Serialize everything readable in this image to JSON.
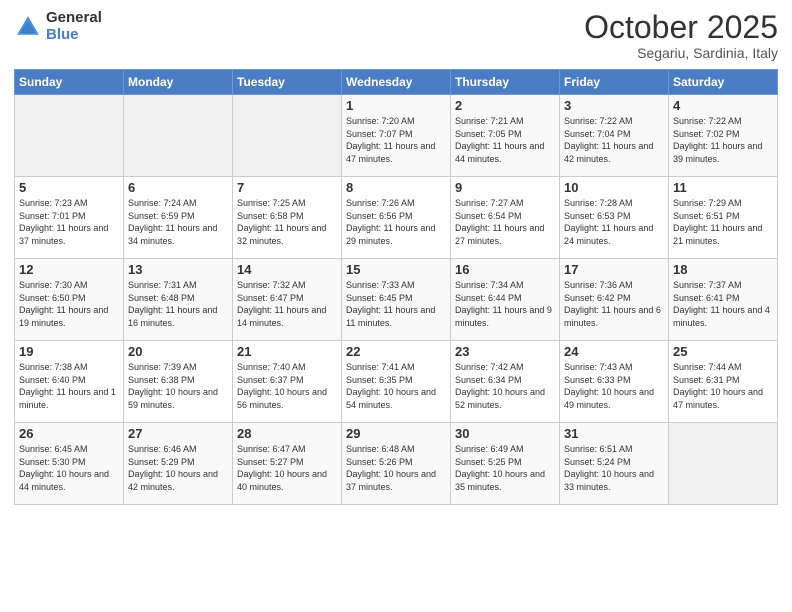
{
  "header": {
    "logo_line1": "General",
    "logo_line2": "Blue",
    "title": "October 2025",
    "subtitle": "Segariu, Sardinia, Italy"
  },
  "days_of_week": [
    "Sunday",
    "Monday",
    "Tuesday",
    "Wednesday",
    "Thursday",
    "Friday",
    "Saturday"
  ],
  "weeks": [
    [
      {
        "day": "",
        "content": ""
      },
      {
        "day": "",
        "content": ""
      },
      {
        "day": "",
        "content": ""
      },
      {
        "day": "1",
        "content": "Sunrise: 7:20 AM\nSunset: 7:07 PM\nDaylight: 11 hours and 47 minutes."
      },
      {
        "day": "2",
        "content": "Sunrise: 7:21 AM\nSunset: 7:05 PM\nDaylight: 11 hours and 44 minutes."
      },
      {
        "day": "3",
        "content": "Sunrise: 7:22 AM\nSunset: 7:04 PM\nDaylight: 11 hours and 42 minutes."
      },
      {
        "day": "4",
        "content": "Sunrise: 7:22 AM\nSunset: 7:02 PM\nDaylight: 11 hours and 39 minutes."
      }
    ],
    [
      {
        "day": "5",
        "content": "Sunrise: 7:23 AM\nSunset: 7:01 PM\nDaylight: 11 hours and 37 minutes."
      },
      {
        "day": "6",
        "content": "Sunrise: 7:24 AM\nSunset: 6:59 PM\nDaylight: 11 hours and 34 minutes."
      },
      {
        "day": "7",
        "content": "Sunrise: 7:25 AM\nSunset: 6:58 PM\nDaylight: 11 hours and 32 minutes."
      },
      {
        "day": "8",
        "content": "Sunrise: 7:26 AM\nSunset: 6:56 PM\nDaylight: 11 hours and 29 minutes."
      },
      {
        "day": "9",
        "content": "Sunrise: 7:27 AM\nSunset: 6:54 PM\nDaylight: 11 hours and 27 minutes."
      },
      {
        "day": "10",
        "content": "Sunrise: 7:28 AM\nSunset: 6:53 PM\nDaylight: 11 hours and 24 minutes."
      },
      {
        "day": "11",
        "content": "Sunrise: 7:29 AM\nSunset: 6:51 PM\nDaylight: 11 hours and 21 minutes."
      }
    ],
    [
      {
        "day": "12",
        "content": "Sunrise: 7:30 AM\nSunset: 6:50 PM\nDaylight: 11 hours and 19 minutes."
      },
      {
        "day": "13",
        "content": "Sunrise: 7:31 AM\nSunset: 6:48 PM\nDaylight: 11 hours and 16 minutes."
      },
      {
        "day": "14",
        "content": "Sunrise: 7:32 AM\nSunset: 6:47 PM\nDaylight: 11 hours and 14 minutes."
      },
      {
        "day": "15",
        "content": "Sunrise: 7:33 AM\nSunset: 6:45 PM\nDaylight: 11 hours and 11 minutes."
      },
      {
        "day": "16",
        "content": "Sunrise: 7:34 AM\nSunset: 6:44 PM\nDaylight: 11 hours and 9 minutes."
      },
      {
        "day": "17",
        "content": "Sunrise: 7:36 AM\nSunset: 6:42 PM\nDaylight: 11 hours and 6 minutes."
      },
      {
        "day": "18",
        "content": "Sunrise: 7:37 AM\nSunset: 6:41 PM\nDaylight: 11 hours and 4 minutes."
      }
    ],
    [
      {
        "day": "19",
        "content": "Sunrise: 7:38 AM\nSunset: 6:40 PM\nDaylight: 11 hours and 1 minute."
      },
      {
        "day": "20",
        "content": "Sunrise: 7:39 AM\nSunset: 6:38 PM\nDaylight: 10 hours and 59 minutes."
      },
      {
        "day": "21",
        "content": "Sunrise: 7:40 AM\nSunset: 6:37 PM\nDaylight: 10 hours and 56 minutes."
      },
      {
        "day": "22",
        "content": "Sunrise: 7:41 AM\nSunset: 6:35 PM\nDaylight: 10 hours and 54 minutes."
      },
      {
        "day": "23",
        "content": "Sunrise: 7:42 AM\nSunset: 6:34 PM\nDaylight: 10 hours and 52 minutes."
      },
      {
        "day": "24",
        "content": "Sunrise: 7:43 AM\nSunset: 6:33 PM\nDaylight: 10 hours and 49 minutes."
      },
      {
        "day": "25",
        "content": "Sunrise: 7:44 AM\nSunset: 6:31 PM\nDaylight: 10 hours and 47 minutes."
      }
    ],
    [
      {
        "day": "26",
        "content": "Sunrise: 6:45 AM\nSunset: 5:30 PM\nDaylight: 10 hours and 44 minutes."
      },
      {
        "day": "27",
        "content": "Sunrise: 6:46 AM\nSunset: 5:29 PM\nDaylight: 10 hours and 42 minutes."
      },
      {
        "day": "28",
        "content": "Sunrise: 6:47 AM\nSunset: 5:27 PM\nDaylight: 10 hours and 40 minutes."
      },
      {
        "day": "29",
        "content": "Sunrise: 6:48 AM\nSunset: 5:26 PM\nDaylight: 10 hours and 37 minutes."
      },
      {
        "day": "30",
        "content": "Sunrise: 6:49 AM\nSunset: 5:25 PM\nDaylight: 10 hours and 35 minutes."
      },
      {
        "day": "31",
        "content": "Sunrise: 6:51 AM\nSunset: 5:24 PM\nDaylight: 10 hours and 33 minutes."
      },
      {
        "day": "",
        "content": ""
      }
    ]
  ]
}
